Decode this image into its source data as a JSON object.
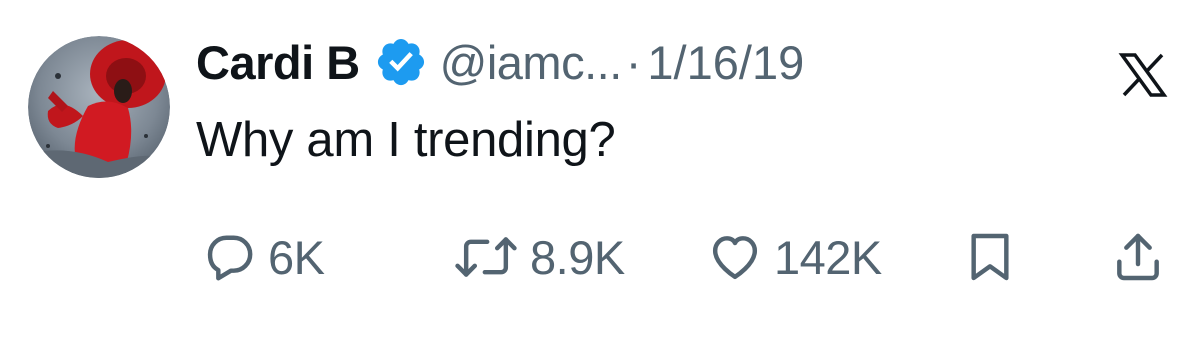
{
  "tweet": {
    "author_name": "Cardi B",
    "handle": "@iamc...",
    "separator": "·",
    "date": "1/16/19",
    "text": "Why am I trending?",
    "verified": true
  },
  "stats": {
    "replies": "6K",
    "retweets": "8.9K",
    "likes": "142K"
  },
  "icons": {
    "avatar": "profile-photo",
    "verified": "verified-badge-icon",
    "platform": "x-logo-icon",
    "reply": "reply-icon",
    "retweet": "retweet-icon",
    "like": "heart-icon",
    "bookmark": "bookmark-icon",
    "share": "share-icon"
  },
  "colors": {
    "text_primary": "#0f1419",
    "text_secondary": "#536471",
    "verified_blue": "#1d9bf0",
    "background": "#ffffff"
  }
}
